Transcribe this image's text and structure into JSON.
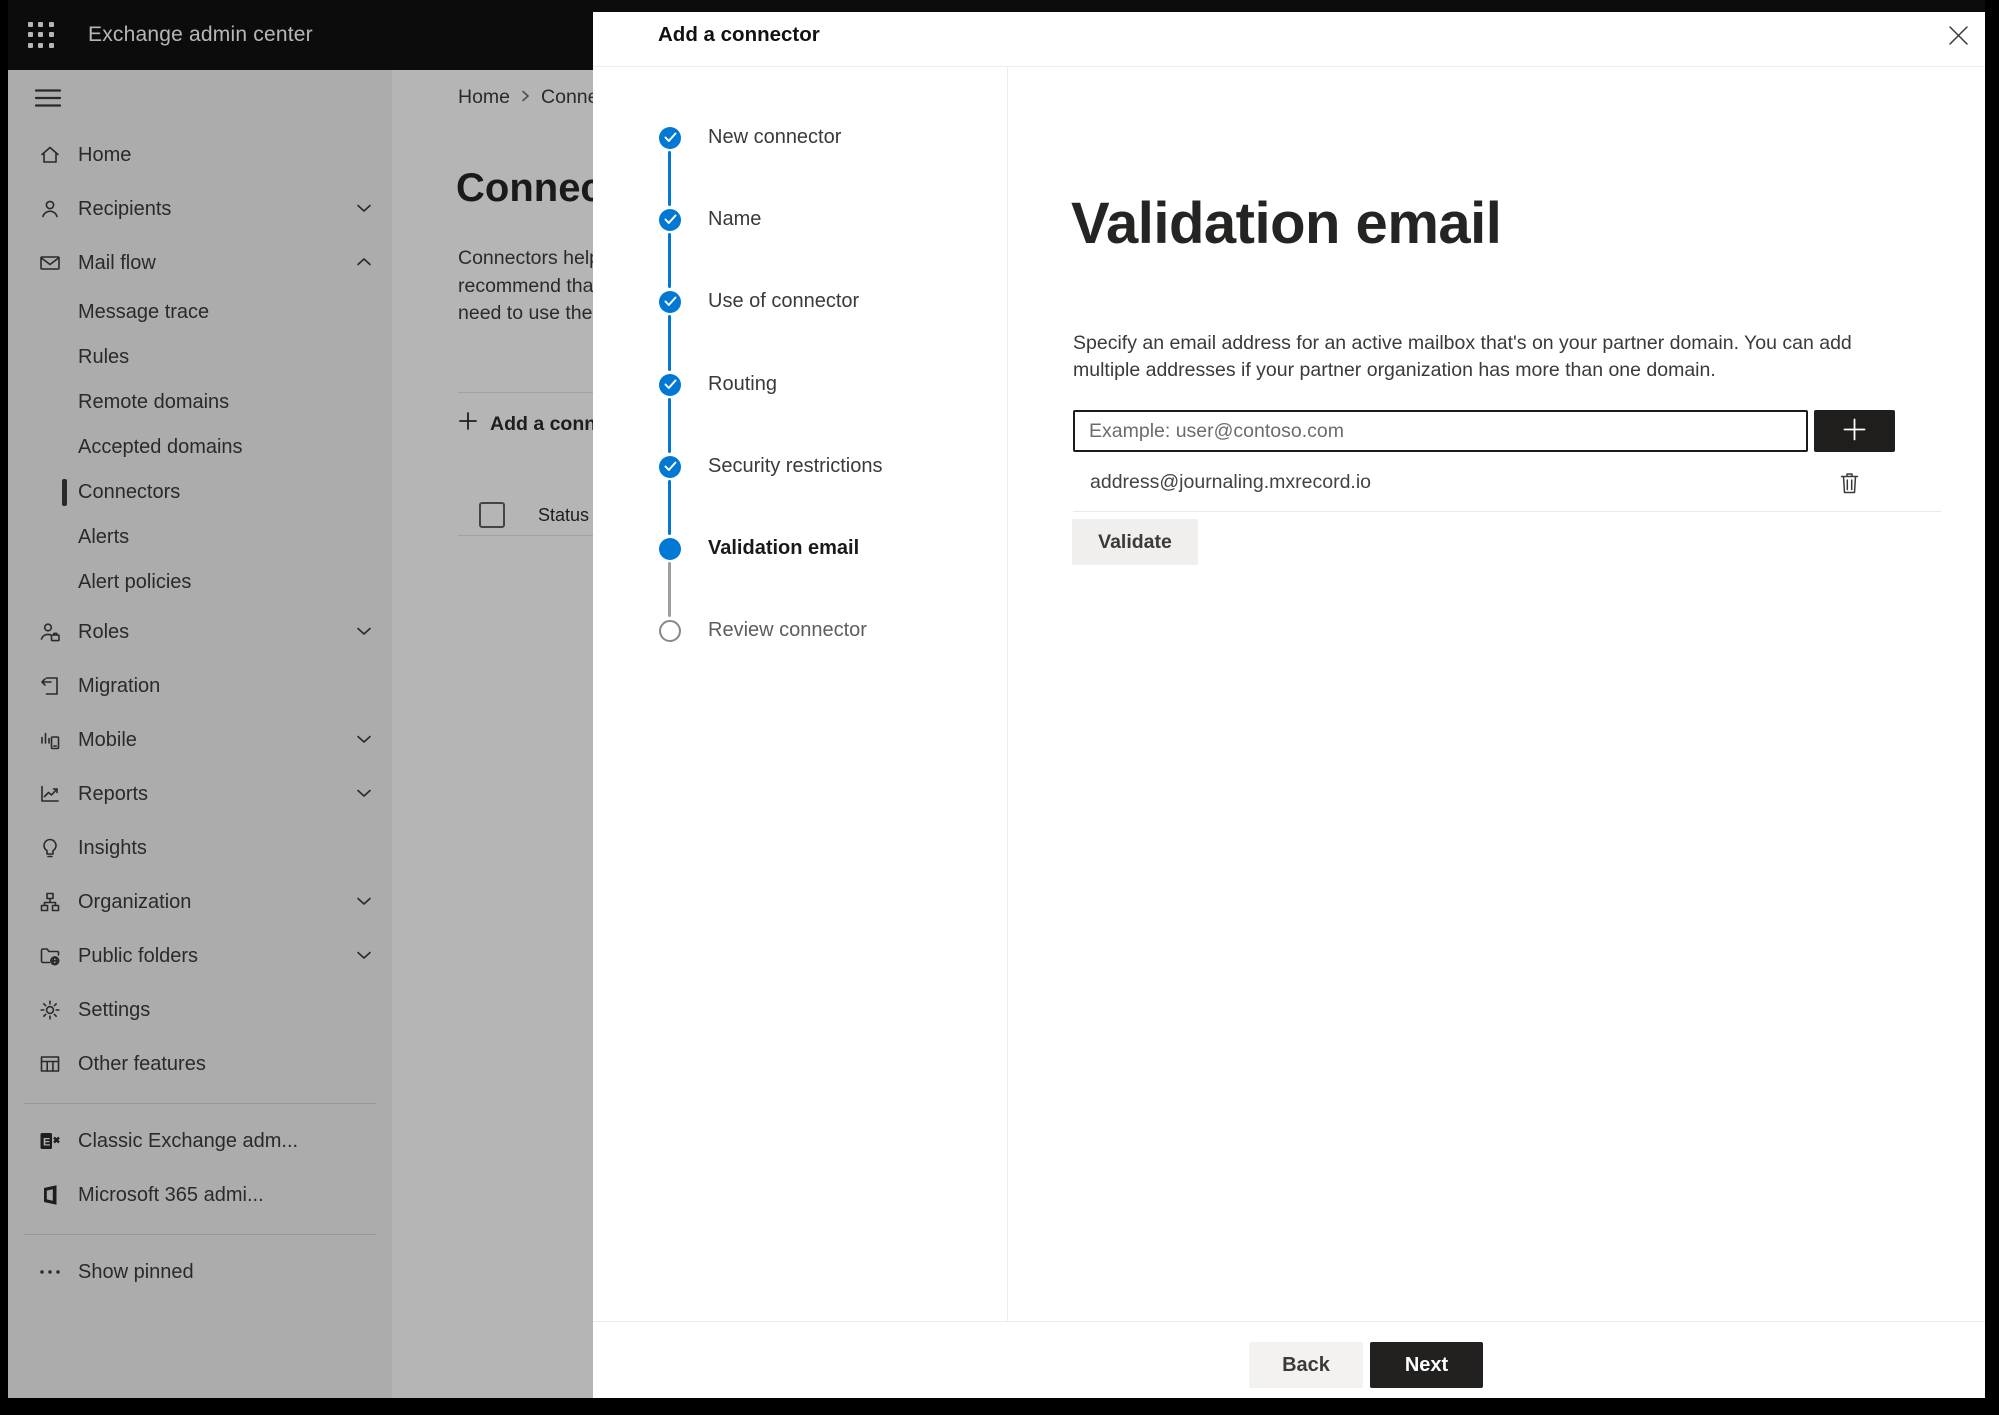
{
  "app": {
    "title": "Exchange admin center"
  },
  "sidebar": {
    "items": [
      {
        "label": "Home"
      },
      {
        "label": "Recipients"
      },
      {
        "label": "Mail flow",
        "children": [
          "Message trace",
          "Rules",
          "Remote domains",
          "Accepted domains",
          "Connectors",
          "Alerts",
          "Alert policies"
        ],
        "selected_child": "Connectors"
      },
      {
        "label": "Roles"
      },
      {
        "label": "Migration"
      },
      {
        "label": "Mobile"
      },
      {
        "label": "Reports"
      },
      {
        "label": "Insights"
      },
      {
        "label": "Organization"
      },
      {
        "label": "Public folders"
      },
      {
        "label": "Settings"
      },
      {
        "label": "Other features"
      }
    ],
    "footer_items": [
      {
        "label": "Classic Exchange adm..."
      },
      {
        "label": "Microsoft 365 admi..."
      }
    ],
    "show_pinned": "Show pinned"
  },
  "page": {
    "breadcrumb": {
      "home": "Home",
      "current": "Conne"
    },
    "title": "Connect",
    "intro_lines": [
      "Connectors help",
      "recommend tha",
      "need to use ther"
    ],
    "add_button": "Add a conn",
    "column_status": "Status"
  },
  "modal": {
    "title": "Add a connector",
    "steps": [
      {
        "label": "New connector",
        "state": "complete"
      },
      {
        "label": "Name",
        "state": "complete"
      },
      {
        "label": "Use of connector",
        "state": "complete"
      },
      {
        "label": "Routing",
        "state": "complete"
      },
      {
        "label": "Security restrictions",
        "state": "complete"
      },
      {
        "label": "Validation email",
        "state": "current"
      },
      {
        "label": "Review connector",
        "state": "upcoming"
      }
    ],
    "content": {
      "heading": "Validation email",
      "description_line1": "Specify an email address for an active mailbox that's on your partner domain. You can add",
      "description_line2": "multiple addresses if your partner organization has more than one domain.",
      "email_input_placeholder": "Example: user@contoso.com",
      "addresses": [
        {
          "email": "address@journaling.mxrecord.io"
        }
      ],
      "validate_button": "Validate"
    },
    "footer": {
      "back": "Back",
      "next": "Next"
    }
  },
  "colors": {
    "accent": "#0078d4",
    "primary_button": "#222120",
    "step_upcoming": "#8a8886"
  }
}
